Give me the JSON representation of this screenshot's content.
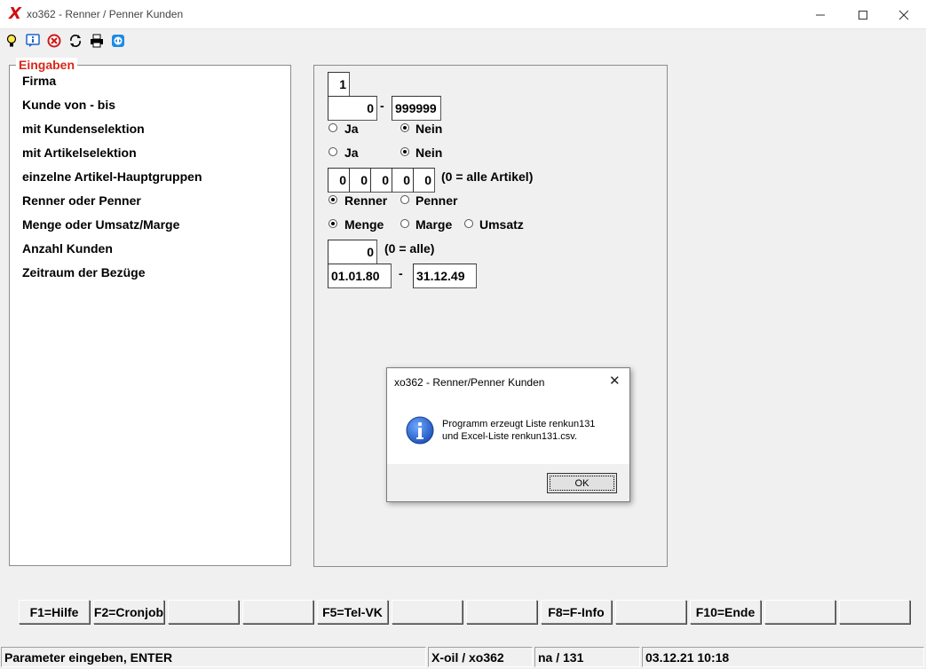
{
  "window": {
    "title": "xo362 - Renner / Penner Kunden",
    "logo": "X"
  },
  "toolbar": {
    "icons": [
      "lightbulb-icon",
      "info-icon",
      "cancel-icon",
      "refresh-icon",
      "printer-icon",
      "teamviewer-icon"
    ]
  },
  "panel": {
    "caption": "Eingaben",
    "labels": [
      "Firma",
      "Kunde von - bis",
      "mit Kundenselektion",
      "mit Artikelselektion",
      "einzelne Artikel-Hauptgruppen",
      "Renner oder Penner",
      "Menge oder Umsatz/Marge",
      "Anzahl Kunden",
      "Zeitraum der Bezüge"
    ]
  },
  "form": {
    "firma": "1",
    "kunde_von": "0",
    "dash": "-",
    "kunde_bis": "999999",
    "kundenselektion": {
      "ja": "Ja",
      "nein": "Nein",
      "selected": "nein"
    },
    "artikelselektion": {
      "ja": "Ja",
      "nein": "Nein",
      "selected": "nein"
    },
    "hauptgruppen": [
      "0",
      "0",
      "0",
      "0",
      "0"
    ],
    "hauptgruppen_hint": "(0 = alle Artikel)",
    "renner_penner": {
      "renner": "Renner",
      "penner": "Penner",
      "selected": "renner"
    },
    "menge_umsatz": {
      "menge": "Menge",
      "marge": "Marge",
      "umsatz": "Umsatz",
      "selected": "menge"
    },
    "anzahl_kunden": "0",
    "anzahl_hint": "(0 = alle)",
    "zeitraum_von": "01.01.80",
    "zeitraum_bis": "31.12.49"
  },
  "fkeys": [
    "F1=Hilfe",
    "F2=Cronjob",
    "",
    "",
    "F5=Tel-VK",
    "",
    "",
    "F8=F-Info",
    "",
    "F10=Ende",
    "",
    ""
  ],
  "statusbar": {
    "message": "Parameter eingeben, ENTER",
    "app": "X-oil / xo362",
    "user": "na / 131",
    "datetime": "03.12.21 10:18"
  },
  "dialog": {
    "title": "xo362 - Renner/Penner Kunden",
    "line1": "Programm erzeugt Liste renkun131",
    "line2": "und Excel-Liste renkun131.csv.",
    "ok_label": "OK"
  },
  "colors": {
    "accent_red": "#d8281a",
    "info_blue": "#1e64c8"
  }
}
